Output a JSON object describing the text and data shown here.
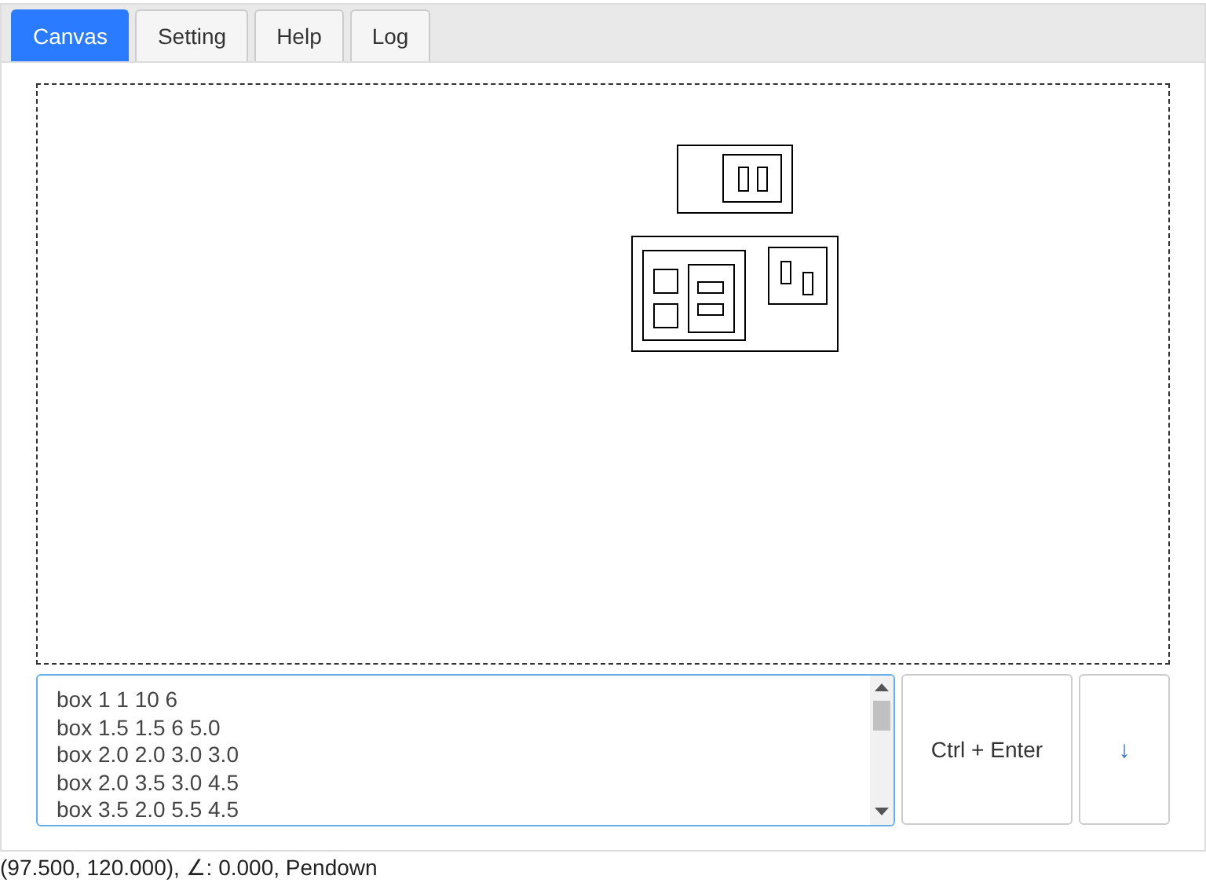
{
  "tabs": [
    {
      "label": "Canvas",
      "selected": true
    },
    {
      "label": "Setting",
      "selected": false
    },
    {
      "label": "Help",
      "selected": false
    },
    {
      "label": "Log",
      "selected": false
    }
  ],
  "editor": {
    "lines": [
      "box 1 1 10 6",
      "box 1.5 1.5 6 5.0",
      "box 2.0 2.0 3.0 3.0",
      "box 2.0 3.5 3.0 4.5",
      "box 3.5 2.0 5.5 4.5"
    ]
  },
  "buttons": [
    {
      "label": "Ctrl + Enter"
    },
    {
      "label": "↓"
    }
  ],
  "status_bar": "(97.500, 120.000), ∠: 0.000, Pendown"
}
